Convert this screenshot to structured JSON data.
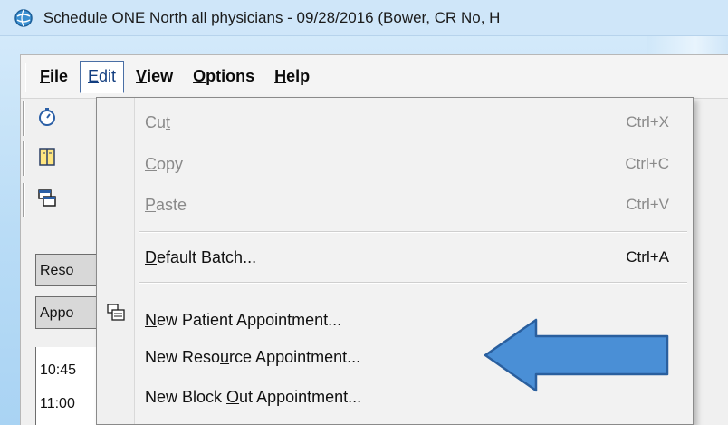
{
  "window": {
    "title": "Schedule ONE North all physicians - 09/28/2016 (Bower, CR No, H",
    "icon": "app-globe-icon"
  },
  "menubar": {
    "items": [
      {
        "label": "File",
        "underline": "F",
        "rest": "ile",
        "active": false
      },
      {
        "label": "Edit",
        "underline": "E",
        "rest": "dit",
        "active": true
      },
      {
        "label": "View",
        "underline": "V",
        "rest": "iew",
        "active": false
      },
      {
        "label": "Options",
        "underline": "O",
        "rest": "ptions",
        "active": false
      },
      {
        "label": "Help",
        "underline": "H",
        "rest": "elp",
        "active": false
      }
    ]
  },
  "toolbar": {
    "icons": [
      "stopwatch-icon",
      "book-icon",
      "windows-icon"
    ]
  },
  "grid": {
    "header1": "Reso",
    "header2": "Appo",
    "times": [
      "10:45",
      "11:00"
    ]
  },
  "edit_menu": {
    "items": [
      {
        "pre": "Cu",
        "u": "t",
        "post": "",
        "shortcut": "Ctrl+X",
        "enabled": false
      },
      {
        "pre": "",
        "u": "C",
        "post": "opy",
        "shortcut": "Ctrl+C",
        "enabled": false
      },
      {
        "pre": "",
        "u": "P",
        "post": "aste",
        "shortcut": "Ctrl+V",
        "enabled": false
      },
      {
        "pre": "",
        "u": "D",
        "post": "efault Batch...",
        "shortcut": "Ctrl+A",
        "enabled": true
      },
      {
        "pre": "",
        "u": "N",
        "post": "ew Patient Appointment...",
        "shortcut": "",
        "enabled": true,
        "icon": "new-appointment-icon"
      },
      {
        "pre": "New Reso",
        "u": "u",
        "post": "rce Appointment...",
        "shortcut": "",
        "enabled": true
      },
      {
        "pre": "New Block ",
        "u": "O",
        "post": "ut Appointment...",
        "shortcut": "",
        "enabled": true
      }
    ]
  },
  "annotation": {
    "arrow_color": "#4a8fd6",
    "arrow_target": "New Resource Appointment..."
  }
}
